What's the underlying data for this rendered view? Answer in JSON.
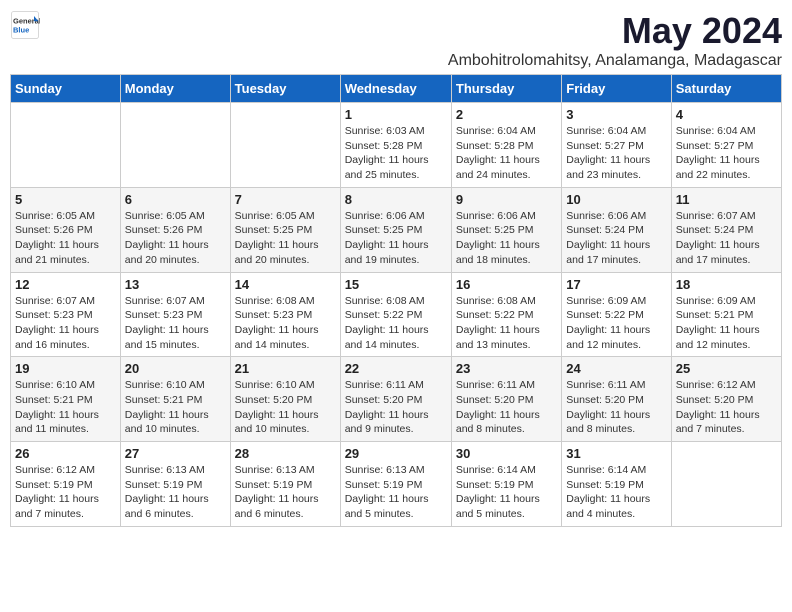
{
  "logo": {
    "general": "General",
    "blue": "Blue"
  },
  "title": "May 2024",
  "location": "Ambohitrolomahitsy, Analamanga, Madagascar",
  "headers": [
    "Sunday",
    "Monday",
    "Tuesday",
    "Wednesday",
    "Thursday",
    "Friday",
    "Saturday"
  ],
  "weeks": [
    [
      {
        "day": "",
        "info": ""
      },
      {
        "day": "",
        "info": ""
      },
      {
        "day": "",
        "info": ""
      },
      {
        "day": "1",
        "info": "Sunrise: 6:03 AM\nSunset: 5:28 PM\nDaylight: 11 hours\nand 25 minutes."
      },
      {
        "day": "2",
        "info": "Sunrise: 6:04 AM\nSunset: 5:28 PM\nDaylight: 11 hours\nand 24 minutes."
      },
      {
        "day": "3",
        "info": "Sunrise: 6:04 AM\nSunset: 5:27 PM\nDaylight: 11 hours\nand 23 minutes."
      },
      {
        "day": "4",
        "info": "Sunrise: 6:04 AM\nSunset: 5:27 PM\nDaylight: 11 hours\nand 22 minutes."
      }
    ],
    [
      {
        "day": "5",
        "info": "Sunrise: 6:05 AM\nSunset: 5:26 PM\nDaylight: 11 hours\nand 21 minutes."
      },
      {
        "day": "6",
        "info": "Sunrise: 6:05 AM\nSunset: 5:26 PM\nDaylight: 11 hours\nand 20 minutes."
      },
      {
        "day": "7",
        "info": "Sunrise: 6:05 AM\nSunset: 5:25 PM\nDaylight: 11 hours\nand 20 minutes."
      },
      {
        "day": "8",
        "info": "Sunrise: 6:06 AM\nSunset: 5:25 PM\nDaylight: 11 hours\nand 19 minutes."
      },
      {
        "day": "9",
        "info": "Sunrise: 6:06 AM\nSunset: 5:25 PM\nDaylight: 11 hours\nand 18 minutes."
      },
      {
        "day": "10",
        "info": "Sunrise: 6:06 AM\nSunset: 5:24 PM\nDaylight: 11 hours\nand 17 minutes."
      },
      {
        "day": "11",
        "info": "Sunrise: 6:07 AM\nSunset: 5:24 PM\nDaylight: 11 hours\nand 17 minutes."
      }
    ],
    [
      {
        "day": "12",
        "info": "Sunrise: 6:07 AM\nSunset: 5:23 PM\nDaylight: 11 hours\nand 16 minutes."
      },
      {
        "day": "13",
        "info": "Sunrise: 6:07 AM\nSunset: 5:23 PM\nDaylight: 11 hours\nand 15 minutes."
      },
      {
        "day": "14",
        "info": "Sunrise: 6:08 AM\nSunset: 5:23 PM\nDaylight: 11 hours\nand 14 minutes."
      },
      {
        "day": "15",
        "info": "Sunrise: 6:08 AM\nSunset: 5:22 PM\nDaylight: 11 hours\nand 14 minutes."
      },
      {
        "day": "16",
        "info": "Sunrise: 6:08 AM\nSunset: 5:22 PM\nDaylight: 11 hours\nand 13 minutes."
      },
      {
        "day": "17",
        "info": "Sunrise: 6:09 AM\nSunset: 5:22 PM\nDaylight: 11 hours\nand 12 minutes."
      },
      {
        "day": "18",
        "info": "Sunrise: 6:09 AM\nSunset: 5:21 PM\nDaylight: 11 hours\nand 12 minutes."
      }
    ],
    [
      {
        "day": "19",
        "info": "Sunrise: 6:10 AM\nSunset: 5:21 PM\nDaylight: 11 hours\nand 11 minutes."
      },
      {
        "day": "20",
        "info": "Sunrise: 6:10 AM\nSunset: 5:21 PM\nDaylight: 11 hours\nand 10 minutes."
      },
      {
        "day": "21",
        "info": "Sunrise: 6:10 AM\nSunset: 5:20 PM\nDaylight: 11 hours\nand 10 minutes."
      },
      {
        "day": "22",
        "info": "Sunrise: 6:11 AM\nSunset: 5:20 PM\nDaylight: 11 hours\nand 9 minutes."
      },
      {
        "day": "23",
        "info": "Sunrise: 6:11 AM\nSunset: 5:20 PM\nDaylight: 11 hours\nand 8 minutes."
      },
      {
        "day": "24",
        "info": "Sunrise: 6:11 AM\nSunset: 5:20 PM\nDaylight: 11 hours\nand 8 minutes."
      },
      {
        "day": "25",
        "info": "Sunrise: 6:12 AM\nSunset: 5:20 PM\nDaylight: 11 hours\nand 7 minutes."
      }
    ],
    [
      {
        "day": "26",
        "info": "Sunrise: 6:12 AM\nSunset: 5:19 PM\nDaylight: 11 hours\nand 7 minutes."
      },
      {
        "day": "27",
        "info": "Sunrise: 6:13 AM\nSunset: 5:19 PM\nDaylight: 11 hours\nand 6 minutes."
      },
      {
        "day": "28",
        "info": "Sunrise: 6:13 AM\nSunset: 5:19 PM\nDaylight: 11 hours\nand 6 minutes."
      },
      {
        "day": "29",
        "info": "Sunrise: 6:13 AM\nSunset: 5:19 PM\nDaylight: 11 hours\nand 5 minutes."
      },
      {
        "day": "30",
        "info": "Sunrise: 6:14 AM\nSunset: 5:19 PM\nDaylight: 11 hours\nand 5 minutes."
      },
      {
        "day": "31",
        "info": "Sunrise: 6:14 AM\nSunset: 5:19 PM\nDaylight: 11 hours\nand 4 minutes."
      },
      {
        "day": "",
        "info": ""
      }
    ]
  ]
}
